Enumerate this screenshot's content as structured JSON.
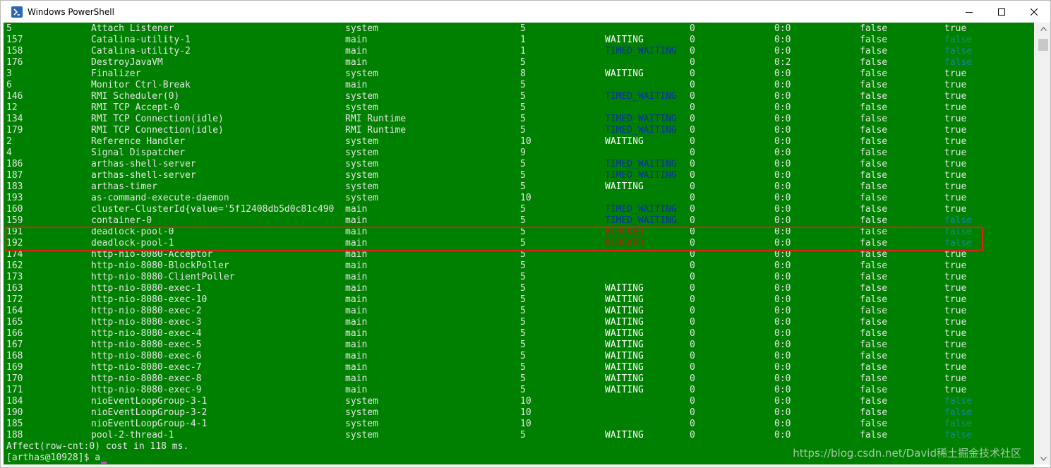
{
  "window": {
    "title": "Windows PowerShell"
  },
  "colors": {
    "console_bg": "#008000",
    "text": "#e6e6e6",
    "waiting": "#ffffff",
    "timed_waiting": "#0a2fa8",
    "blocked": "#c41a1a",
    "false_daemon": "#0f8a9a",
    "highlight": "#e02020"
  },
  "threads": [
    {
      "id": "5",
      "name": "Attach Listener",
      "group": "system",
      "priority": "5",
      "state": "",
      "cpu": "0",
      "time": "0:0",
      "interrupted": "false",
      "daemon": "true"
    },
    {
      "id": "157",
      "name": "Catalina-utility-1",
      "group": "main",
      "priority": "1",
      "state": "WAITING",
      "cpu": "0",
      "time": "0:0",
      "interrupted": "false",
      "daemon": "false"
    },
    {
      "id": "158",
      "name": "Catalina-utility-2",
      "group": "main",
      "priority": "1",
      "state": "TIMED_WAITING",
      "cpu": "0",
      "time": "0:0",
      "interrupted": "false",
      "daemon": "false"
    },
    {
      "id": "176",
      "name": "DestroyJavaVM",
      "group": "main",
      "priority": "5",
      "state": "",
      "cpu": "0",
      "time": "0:2",
      "interrupted": "false",
      "daemon": "false"
    },
    {
      "id": "3",
      "name": "Finalizer",
      "group": "system",
      "priority": "8",
      "state": "WAITING",
      "cpu": "0",
      "time": "0:0",
      "interrupted": "false",
      "daemon": "true"
    },
    {
      "id": "6",
      "name": "Monitor Ctrl-Break",
      "group": "main",
      "priority": "5",
      "state": "",
      "cpu": "0",
      "time": "0:0",
      "interrupted": "false",
      "daemon": "true"
    },
    {
      "id": "146",
      "name": "RMI Scheduler(0)",
      "group": "system",
      "priority": "5",
      "state": "TIMED_WAITING",
      "cpu": "0",
      "time": "0:0",
      "interrupted": "false",
      "daemon": "true"
    },
    {
      "id": "12",
      "name": "RMI TCP Accept-0",
      "group": "system",
      "priority": "5",
      "state": "",
      "cpu": "0",
      "time": "0:0",
      "interrupted": "false",
      "daemon": "true"
    },
    {
      "id": "134",
      "name": "RMI TCP Connection(idle)",
      "group": "RMI Runtime",
      "priority": "5",
      "state": "TIMED_WAITING",
      "cpu": "0",
      "time": "0:0",
      "interrupted": "false",
      "daemon": "true"
    },
    {
      "id": "179",
      "name": "RMI TCP Connection(idle)",
      "group": "RMI Runtime",
      "priority": "5",
      "state": "TIMED_WAITING",
      "cpu": "0",
      "time": "0:0",
      "interrupted": "false",
      "daemon": "true"
    },
    {
      "id": "2",
      "name": "Reference Handler",
      "group": "system",
      "priority": "10",
      "state": "WAITING",
      "cpu": "0",
      "time": "0:0",
      "interrupted": "false",
      "daemon": "true"
    },
    {
      "id": "4",
      "name": "Signal Dispatcher",
      "group": "system",
      "priority": "9",
      "state": "",
      "cpu": "0",
      "time": "0:0",
      "interrupted": "false",
      "daemon": "true"
    },
    {
      "id": "186",
      "name": "arthas-shell-server",
      "group": "system",
      "priority": "5",
      "state": "TIMED_WAITING",
      "cpu": "0",
      "time": "0:0",
      "interrupted": "false",
      "daemon": "true"
    },
    {
      "id": "187",
      "name": "arthas-shell-server",
      "group": "system",
      "priority": "5",
      "state": "TIMED_WAITING",
      "cpu": "0",
      "time": "0:0",
      "interrupted": "false",
      "daemon": "true"
    },
    {
      "id": "183",
      "name": "arthas-timer",
      "group": "system",
      "priority": "5",
      "state": "WAITING",
      "cpu": "0",
      "time": "0:0",
      "interrupted": "false",
      "daemon": "true"
    },
    {
      "id": "193",
      "name": "as-command-execute-daemon",
      "group": "system",
      "priority": "10",
      "state": "",
      "cpu": "0",
      "time": "0:0",
      "interrupted": "false",
      "daemon": "true"
    },
    {
      "id": "160",
      "name": "cluster-ClusterId{value='5f12408db5d0c81c490",
      "group": "main",
      "priority": "5",
      "state": "TIMED_WAITING",
      "cpu": "0",
      "time": "0:0",
      "interrupted": "false",
      "daemon": "true"
    },
    {
      "id": "159",
      "name": "container-0",
      "group": "main",
      "priority": "5",
      "state": "TIMED_WAITING",
      "cpu": "0",
      "time": "0:0",
      "interrupted": "false",
      "daemon": "false"
    },
    {
      "id": "191",
      "name": "deadlock-pool-0",
      "group": "main",
      "priority": "5",
      "state": "BLOCKED",
      "cpu": "0",
      "time": "0:0",
      "interrupted": "false",
      "daemon": "false"
    },
    {
      "id": "192",
      "name": "deadlock-pool-1",
      "group": "main",
      "priority": "5",
      "state": "BLOCKED",
      "cpu": "0",
      "time": "0:0",
      "interrupted": "false",
      "daemon": "false"
    },
    {
      "id": "174",
      "name": "http-nio-8080-Acceptor",
      "group": "main",
      "priority": "5",
      "state": "",
      "cpu": "0",
      "time": "0:0",
      "interrupted": "false",
      "daemon": "true"
    },
    {
      "id": "162",
      "name": "http-nio-8080-BlockPoller",
      "group": "main",
      "priority": "5",
      "state": "",
      "cpu": "0",
      "time": "0:0",
      "interrupted": "false",
      "daemon": "true"
    },
    {
      "id": "173",
      "name": "http-nio-8080-ClientPoller",
      "group": "main",
      "priority": "5",
      "state": "",
      "cpu": "0",
      "time": "0:0",
      "interrupted": "false",
      "daemon": "true"
    },
    {
      "id": "163",
      "name": "http-nio-8080-exec-1",
      "group": "main",
      "priority": "5",
      "state": "WAITING",
      "cpu": "0",
      "time": "0:0",
      "interrupted": "false",
      "daemon": "true"
    },
    {
      "id": "172",
      "name": "http-nio-8080-exec-10",
      "group": "main",
      "priority": "5",
      "state": "WAITING",
      "cpu": "0",
      "time": "0:0",
      "interrupted": "false",
      "daemon": "true"
    },
    {
      "id": "164",
      "name": "http-nio-8080-exec-2",
      "group": "main",
      "priority": "5",
      "state": "WAITING",
      "cpu": "0",
      "time": "0:0",
      "interrupted": "false",
      "daemon": "true"
    },
    {
      "id": "165",
      "name": "http-nio-8080-exec-3",
      "group": "main",
      "priority": "5",
      "state": "WAITING",
      "cpu": "0",
      "time": "0:0",
      "interrupted": "false",
      "daemon": "true"
    },
    {
      "id": "166",
      "name": "http-nio-8080-exec-4",
      "group": "main",
      "priority": "5",
      "state": "WAITING",
      "cpu": "0",
      "time": "0:0",
      "interrupted": "false",
      "daemon": "true"
    },
    {
      "id": "167",
      "name": "http-nio-8080-exec-5",
      "group": "main",
      "priority": "5",
      "state": "WAITING",
      "cpu": "0",
      "time": "0:0",
      "interrupted": "false",
      "daemon": "true"
    },
    {
      "id": "168",
      "name": "http-nio-8080-exec-6",
      "group": "main",
      "priority": "5",
      "state": "WAITING",
      "cpu": "0",
      "time": "0:0",
      "interrupted": "false",
      "daemon": "true"
    },
    {
      "id": "169",
      "name": "http-nio-8080-exec-7",
      "group": "main",
      "priority": "5",
      "state": "WAITING",
      "cpu": "0",
      "time": "0:0",
      "interrupted": "false",
      "daemon": "true"
    },
    {
      "id": "170",
      "name": "http-nio-8080-exec-8",
      "group": "main",
      "priority": "5",
      "state": "WAITING",
      "cpu": "0",
      "time": "0:0",
      "interrupted": "false",
      "daemon": "true"
    },
    {
      "id": "171",
      "name": "http-nio-8080-exec-9",
      "group": "main",
      "priority": "5",
      "state": "WAITING",
      "cpu": "0",
      "time": "0:0",
      "interrupted": "false",
      "daemon": "true"
    },
    {
      "id": "184",
      "name": "nioEventLoopGroup-3-1",
      "group": "system",
      "priority": "10",
      "state": "",
      "cpu": "0",
      "time": "0:0",
      "interrupted": "false",
      "daemon": "false"
    },
    {
      "id": "190",
      "name": "nioEventLoopGroup-3-2",
      "group": "system",
      "priority": "10",
      "state": "",
      "cpu": "0",
      "time": "0:0",
      "interrupted": "false",
      "daemon": "false"
    },
    {
      "id": "185",
      "name": "nioEventLoopGroup-4-1",
      "group": "system",
      "priority": "10",
      "state": "",
      "cpu": "0",
      "time": "0:0",
      "interrupted": "false",
      "daemon": "false"
    },
    {
      "id": "188",
      "name": "pool-2-thread-1",
      "group": "system",
      "priority": "5",
      "state": "WAITING",
      "cpu": "0",
      "time": "0:0",
      "interrupted": "false",
      "daemon": "false"
    }
  ],
  "footer": {
    "affect": "Affect(row-cnt:0) cost in 118 ms.",
    "prompt": "[arthas@10928]$ a"
  },
  "watermark": "https://blog.csdn.net/David稀土掘金技术社区",
  "icons": {
    "app": "powershell-icon",
    "minimize": "minimize-icon",
    "maximize": "maximize-icon",
    "close": "close-icon"
  }
}
